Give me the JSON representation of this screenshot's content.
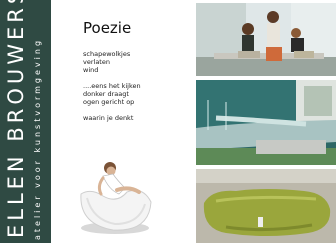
{
  "sidebar": {
    "brand_name": "ELLEN BROUWERS",
    "tagline": "atelier voor kunstvormgeving"
  },
  "poem": {
    "title": "Poezie",
    "stanzas": [
      [
        "schapewolkjes",
        "verlaten",
        "wind"
      ],
      [
        "....eens het kijken",
        "donker draagt",
        "ogen gericht op"
      ],
      [
        "waarin je denkt"
      ]
    ]
  },
  "photos": [
    {
      "name": "women-on-bench-photo"
    },
    {
      "name": "water-lounge-photo"
    },
    {
      "name": "green-lounger-photo"
    }
  ],
  "colors": {
    "sidebar": "#2f4a43",
    "accent_green": "#9aa63c"
  }
}
